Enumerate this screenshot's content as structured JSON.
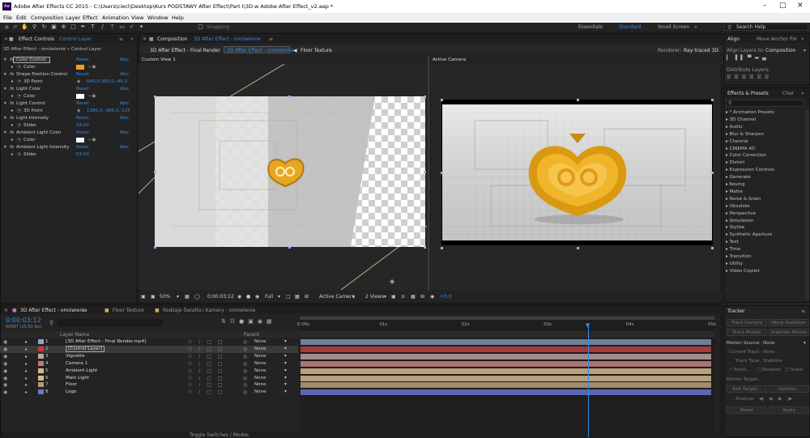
{
  "app": {
    "title": "Adobe After Effects CC 2015 - C:\\Users\\ciecl\\Desktop\\Kurs PODSTAWY After Effect\\Part I\\3D w Adobe After Effect_v2.aep *",
    "icon_text": "Ae"
  },
  "menu": [
    "File",
    "Edit",
    "Composition",
    "Layer",
    "Effect",
    "Animation",
    "View",
    "Window",
    "Help"
  ],
  "toolbar": {
    "snapping": "Snapping",
    "workspaces": [
      "Essentials",
      "Standard",
      "Small Screen"
    ],
    "active_workspace": "Standard",
    "search_placeholder": "Search Help"
  },
  "effect_controls": {
    "tab_label": "Effect Controls",
    "tab_layer": "Control Layer",
    "breadcrumb": "3D After Effect - omówienie • Control Layer",
    "rows": [
      {
        "label": "Color Control",
        "reset": "Reset",
        "abo": "Abo",
        "highlight": true
      },
      {
        "label": "Color",
        "kind": "color",
        "color": "#f0a020"
      },
      {
        "label": "Shape Position Control",
        "reset": "Reset",
        "abo": "Abo"
      },
      {
        "label": "3D Point",
        "value": "640,0,360,0,-45,0"
      },
      {
        "label": "Light Color",
        "reset": "Reset",
        "abo": "Abo"
      },
      {
        "label": "Color",
        "kind": "color",
        "color": "#ffffff"
      },
      {
        "label": "Light Control",
        "reset": "Reset",
        "abo": "Abo"
      },
      {
        "label": "3D Point",
        "value": "1380,0,-386,0,-125"
      },
      {
        "label": "Light Intensity",
        "reset": "Reset",
        "abo": "Abo"
      },
      {
        "label": "Slider",
        "value": "59,00"
      },
      {
        "label": "Ambient Light Color",
        "reset": "Reset",
        "abo": "Abo"
      },
      {
        "label": "Color",
        "kind": "color",
        "color": "#ffffff"
      },
      {
        "label": "Ambient Light Intensity",
        "reset": "Reset",
        "abo": "Abo"
      },
      {
        "label": "Slider",
        "value": "53,00"
      }
    ]
  },
  "composition": {
    "tab_label": "Composition",
    "tab_name": "3D After Effect - omówienie",
    "breadcrumbs": [
      "3D After Effect - Final Render",
      "3D After Effect - omówienie",
      "Floor Texture"
    ],
    "renderer_label": "Renderer:",
    "renderer_value": "Ray-traced 3D",
    "left_view": "Custom View 1",
    "right_view": "Active Camera",
    "zoom": "50%",
    "timecode": "0:00:03:12",
    "resolution": "Full",
    "camera": "Active Camera",
    "views": "2 Views",
    "exposure": "+0,0"
  },
  "align": {
    "tab": "Align",
    "tab2": "Move Anchor Poi",
    "align_to_label": "Align Layers to:",
    "align_to_value": "Composition",
    "distribute_label": "Distribute Layers:"
  },
  "effects_presets": {
    "tab": "Effects & Presets",
    "tab2": "Char",
    "items": [
      "* Animation Presets",
      "3D Channel",
      "Audio",
      "Blur & Sharpen",
      "Channel",
      "CINEMA 4D",
      "Color Correction",
      "Distort",
      "Expression Controls",
      "Generate",
      "Keying",
      "Matte",
      "Noise & Grain",
      "Obsolete",
      "Perspective",
      "Simulation",
      "Stylize",
      "Synthetic Aperture",
      "Text",
      "Time",
      "Transition",
      "Utility",
      "Video Copilot"
    ]
  },
  "timeline": {
    "tabs": [
      "3D After Effect - omówienie",
      "Floor Texture",
      "Rodzaje Światła i Kamery - omówienie"
    ],
    "timecode": "0:00:03:12",
    "frame_info": "00087 (25.00 fps)",
    "layer_name_header": "Layer Name",
    "parent_header": "Parent",
    "ruler": [
      "0:00s",
      "01s",
      "02s",
      "03s",
      "04s",
      "05s"
    ],
    "playhead_fraction": 0.7,
    "layers": [
      {
        "num": "1",
        "name": "[3D After Effect - Final Render.mp4]",
        "parent": "None",
        "color": "#8fa3bf",
        "bar": "#6f7f98"
      },
      {
        "num": "2",
        "name": "[Control Layer]",
        "parent": "None",
        "color": "#cc3b3b",
        "bar": "#a73a3a",
        "selected": true
      },
      {
        "num": "3",
        "name": "Vignette",
        "parent": "None",
        "color": "#c2a4a4",
        "bar": "#a38b8b"
      },
      {
        "num": "4",
        "name": "Camera 1",
        "parent": "None",
        "color": "#c47a7a",
        "bar": "#a77575"
      },
      {
        "num": "5",
        "name": "Ambient Light",
        "parent": "None",
        "color": "#d3b98f",
        "bar": "#b7a07a"
      },
      {
        "num": "6",
        "name": "Main Light",
        "parent": "None",
        "color": "#d3b98f",
        "bar": "#b7a07a"
      },
      {
        "num": "7",
        "name": "Floor",
        "parent": "None",
        "color": "#b59a7a",
        "bar": "#a28a71"
      },
      {
        "num": "8",
        "name": "Logo",
        "parent": "None",
        "color": "#6e79c9",
        "bar": "#5b67b3"
      }
    ],
    "footer": "Toggle Switches / Modes"
  },
  "tracker": {
    "tab": "Tracker",
    "track_camera": "Track Camera",
    "warp_stabilizer": "Warp Stabilizer",
    "track_motion": "Track Motion",
    "stabilize_motion": "Stabilize Motion",
    "motion_source_label": "Motion Source:",
    "motion_source": "None",
    "current_track_label": "Current Track:",
    "current_track": "None",
    "track_type_label": "Track Type:",
    "track_type": "Stabilize",
    "position": "Positi...",
    "rotation": "Rotation",
    "scale": "Scale",
    "motion_target": "Motion Target:",
    "edit_target": "Edit Target...",
    "options": "Options...",
    "analyze": "Analyze:",
    "reset": "Reset",
    "apply": "Apply"
  }
}
